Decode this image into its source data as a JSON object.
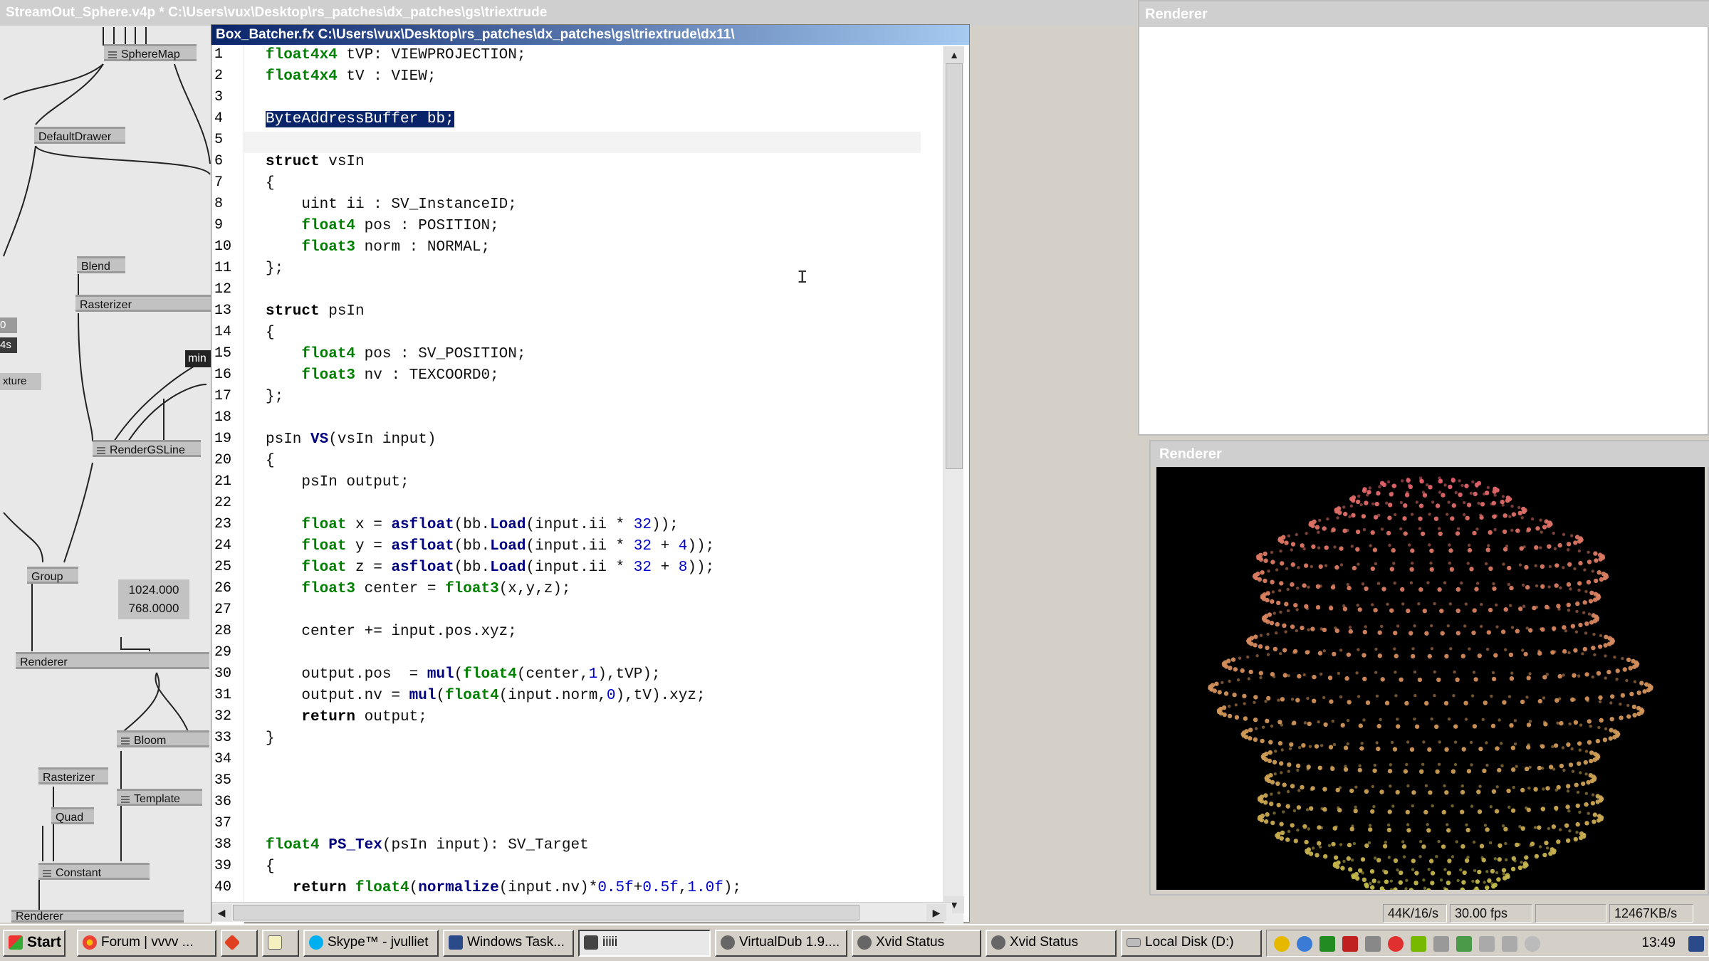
{
  "patch": {
    "title": "StreamOut_Sphere.v4p *   C:\\Users\\vux\\Desktop\\rs_patches\\dx_patches\\gs\\triextrude",
    "nodes": {
      "sphere_map": "SphereMap",
      "default_drawer": "DefaultDrawer",
      "blend": "Blend",
      "rasterizer_top": "Rasterizer",
      "render_gs_line": "RenderGSLine",
      "group": "Group",
      "renderer": "Renderer",
      "bloom": "Bloom",
      "rasterizer_bottom": "Rasterizer",
      "template": "Template",
      "quad": "Quad",
      "constant": "Constant",
      "renderer_bottom": "Renderer",
      "texture_fragment": "xture",
      "min_fragment": "min",
      "left_val_1": "0",
      "left_val_2": "4s"
    },
    "iobox_values": [
      "1024.000",
      "768.0000"
    ]
  },
  "editor": {
    "title": "Box_Batcher.fx   C:\\Users\\vux\\Desktop\\rs_patches\\dx_patches\\gs\\triextrude\\dx11\\",
    "line_numbers": [
      "1",
      "2",
      "3",
      "4",
      "5",
      "6",
      "7",
      "8",
      "9",
      "10",
      "11",
      "12",
      "13",
      "14",
      "15",
      "16",
      "17",
      "18",
      "19",
      "20",
      "21",
      "22",
      "23",
      "24",
      "25",
      "26",
      "27",
      "28",
      "29",
      "30",
      "31",
      "32",
      "33",
      "34",
      "35",
      "36",
      "37",
      "38",
      "39",
      "40"
    ],
    "code": {
      "l1": [
        "float4x4",
        " tVP: VIEWPROJECTION;"
      ],
      "l2": [
        "float4x4",
        " tV : VIEW;"
      ],
      "l4": "ByteAddressBuffer bb;",
      "l6": [
        "struct",
        " vsIn"
      ],
      "l7": "{",
      "l8": "    uint ii : SV_InstanceID;",
      "l9": [
        "    ",
        "float4",
        " pos : POSITION;"
      ],
      "l10": [
        "    ",
        "float3",
        " norm : NORMAL;"
      ],
      "l11": "};",
      "l13": [
        "struct",
        " psIn"
      ],
      "l14": "{",
      "l15": [
        "    ",
        "float4",
        " pos : SV_POSITION;"
      ],
      "l16": [
        "    ",
        "float3",
        " nv : TEXCOORD0;"
      ],
      "l17": "};",
      "l19": [
        "psIn ",
        "VS",
        "(vsIn input)"
      ],
      "l20": "{",
      "l21": "    psIn output;",
      "l23": [
        "    ",
        "float",
        " x = ",
        "asfloat",
        "(bb.",
        "Load",
        "(input.ii * ",
        "32",
        "));"
      ],
      "l24": [
        "    ",
        "float",
        " y = ",
        "asfloat",
        "(bb.",
        "Load",
        "(input.ii * ",
        "32",
        " + ",
        "4",
        "));"
      ],
      "l25": [
        "    ",
        "float",
        " z = ",
        "asfloat",
        "(bb.",
        "Load",
        "(input.ii * ",
        "32",
        " + ",
        "8",
        "));"
      ],
      "l26": [
        "    ",
        "float3",
        " center = ",
        "float3",
        "(x,y,z);"
      ],
      "l28": "    center += input.pos.xyz;",
      "l30": [
        "    output.pos  = ",
        "mul",
        "(",
        "float4",
        "(center,",
        "1",
        "),tVP);"
      ],
      "l31": [
        "    output.nv = ",
        "mul",
        "(",
        "float4",
        "(input.norm,",
        "0",
        "),tV).xyz;"
      ],
      "l32": [
        "    ",
        "return",
        " output;"
      ],
      "l33": "}",
      "l38": [
        "float4",
        " ",
        "PS_Tex",
        "(psIn input): SV_Target"
      ],
      "l39": "{",
      "l40": [
        "   ",
        "return",
        " ",
        "float4",
        "(",
        "normalize",
        "(input.nv)*",
        "0.5f",
        "+",
        "0.5f",
        ",",
        "1.0f",
        ");"
      ]
    }
  },
  "renderer_top": {
    "title": "Renderer"
  },
  "renderer_bottom": {
    "title": "Renderer"
  },
  "statusbar": {
    "rate": "44K/16/s",
    "fps": "30.00 fps",
    "throughput": "12467KB/s"
  },
  "taskbar": {
    "start": "Start",
    "items": [
      "Forum | vvvv ...",
      "",
      "",
      "Skype™ - jvulliet",
      "Windows Task...",
      "iiiii",
      "VirtualDub 1.9....",
      "Xvid Status",
      "Xvid Status",
      "Local Disk (D:)"
    ],
    "clock": "13:49"
  },
  "colors": {
    "selection": "#0a246a",
    "type_keyword": "#008000",
    "intrinsic": "#000080",
    "number": "#0000cc"
  }
}
